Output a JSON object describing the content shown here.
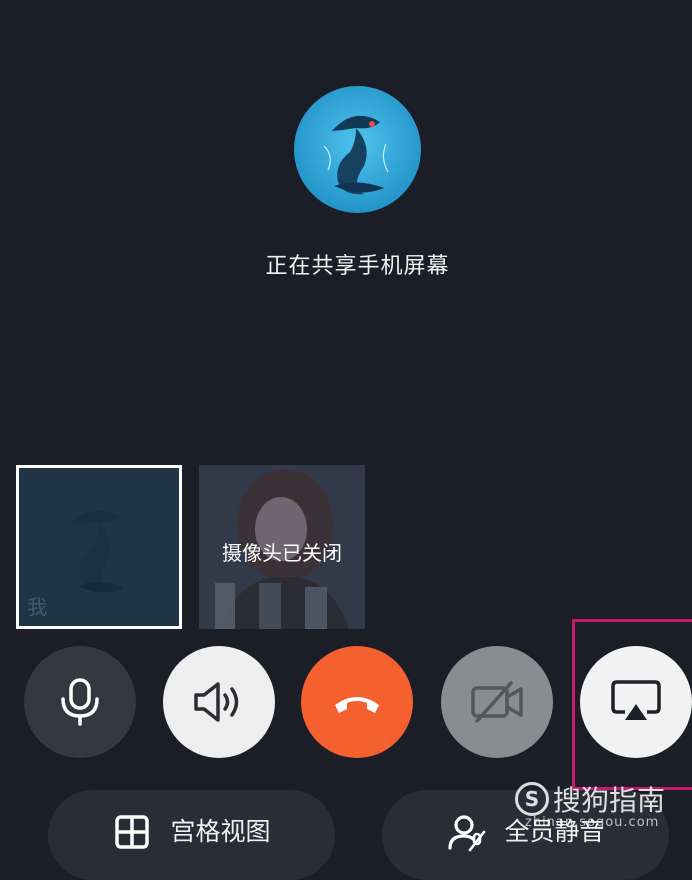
{
  "share": {
    "status_text": "正在共享手机屏幕"
  },
  "tiles": {
    "self_label": "我",
    "remote_status": "摄像头已关闭"
  },
  "controls": {
    "mic": "microphone-icon",
    "speaker": "speaker-icon",
    "hangup": "hang-up-icon",
    "camera": "camera-off-icon",
    "screen_share": "screen-share-icon"
  },
  "bottom": {
    "grid_view_label": "宫格视图",
    "mute_all_label": "全员静音"
  },
  "watermark": {
    "logo_letter": "S",
    "text": "搜狗指南",
    "url": "zhinan.sogou.com"
  },
  "colors": {
    "background": "#1b1e27",
    "hangup": "#f4612f",
    "highlight_box": "#c21a6e"
  }
}
